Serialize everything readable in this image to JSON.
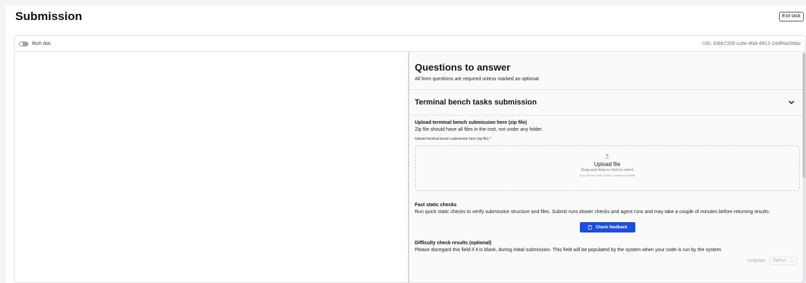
{
  "header": {
    "title": "Submission",
    "exit_label": "Exit task"
  },
  "editor_bar": {
    "toggle_label": "Rich doc",
    "uid": "UID: 83bb7209-cc8e-4fa6-8912-24dff4a09dac"
  },
  "questions": {
    "title": "Questions to answer",
    "subtitle": "All form questions are required unless marked as optional."
  },
  "section": {
    "title": "Terminal bench tasks submission",
    "icon": "chevron-down-icon"
  },
  "upload_field": {
    "label": "Upload terminal bench submission here (zip file)",
    "description": "Zip file should have all files in the root, not under any folder.",
    "small_label": "Upload terminal bench submission here (zip file) *",
    "icon": "upload-icon",
    "dropzone_title": "Upload file",
    "dropzone_sub": "Drag and drop or click to select",
    "dropzone_hint": "Only ZIP and TAR.GZ files, maximum 500MB"
  },
  "static_checks": {
    "label": "Fast static checks",
    "description": "Run quick static checks to verify submission structure and files. Submit runs slower checks and agent runs and may take a couple of minutes before returning results.",
    "button_label": "Check feedback",
    "button_icon": "clipboard-icon"
  },
  "difficulty": {
    "label": "Difficulty check results (optional)",
    "description": "Please disregard this field if it is blank, during initial submission. This field will be populated by the system when your code is run by the system."
  },
  "language": {
    "label": "Language:",
    "selected": "Python"
  },
  "colors": {
    "accent": "#1d4ed8",
    "background": "#f4f4f5"
  }
}
